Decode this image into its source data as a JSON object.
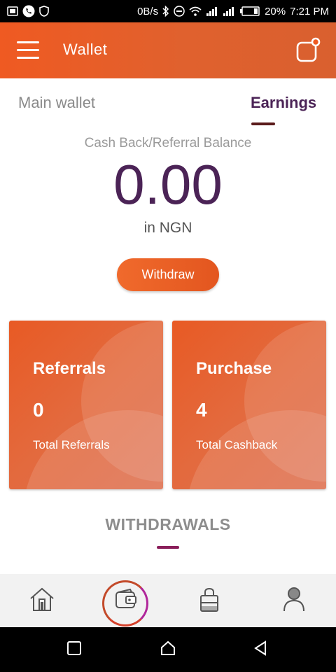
{
  "status_bar": {
    "speed": "0B/s",
    "battery": "20%",
    "time": "7:21 PM"
  },
  "app_bar": {
    "title": "Wallet",
    "menu_icon": "hamburger-menu-icon",
    "action_icon": "notification-square-icon"
  },
  "tabs": [
    {
      "label": "Main wallet",
      "active": false
    },
    {
      "label": "Earnings",
      "active": true
    }
  ],
  "balance": {
    "label": "Cash Back/Referral Balance",
    "amount": "0.00",
    "currency": "in NGN",
    "withdraw_label": "Withdraw"
  },
  "cards": [
    {
      "title": "Referrals",
      "value": "0",
      "subtitle": "Total Referrals"
    },
    {
      "title": "Purchase",
      "value": "4",
      "subtitle": "Total Cashback"
    }
  ],
  "withdrawals": {
    "title": "WITHDRAWALS"
  },
  "bottom_nav": [
    {
      "icon": "home-icon",
      "active": false
    },
    {
      "icon": "wallet-icon",
      "active": true
    },
    {
      "icon": "shopping-bag-icon",
      "active": false
    },
    {
      "icon": "profile-icon",
      "active": false
    }
  ],
  "colors": {
    "brand_orange": "#ef5a22",
    "accent_purple": "#4b2356",
    "tab_indicator": "#5a1b1b",
    "section_indicator": "#8a1e5a"
  }
}
